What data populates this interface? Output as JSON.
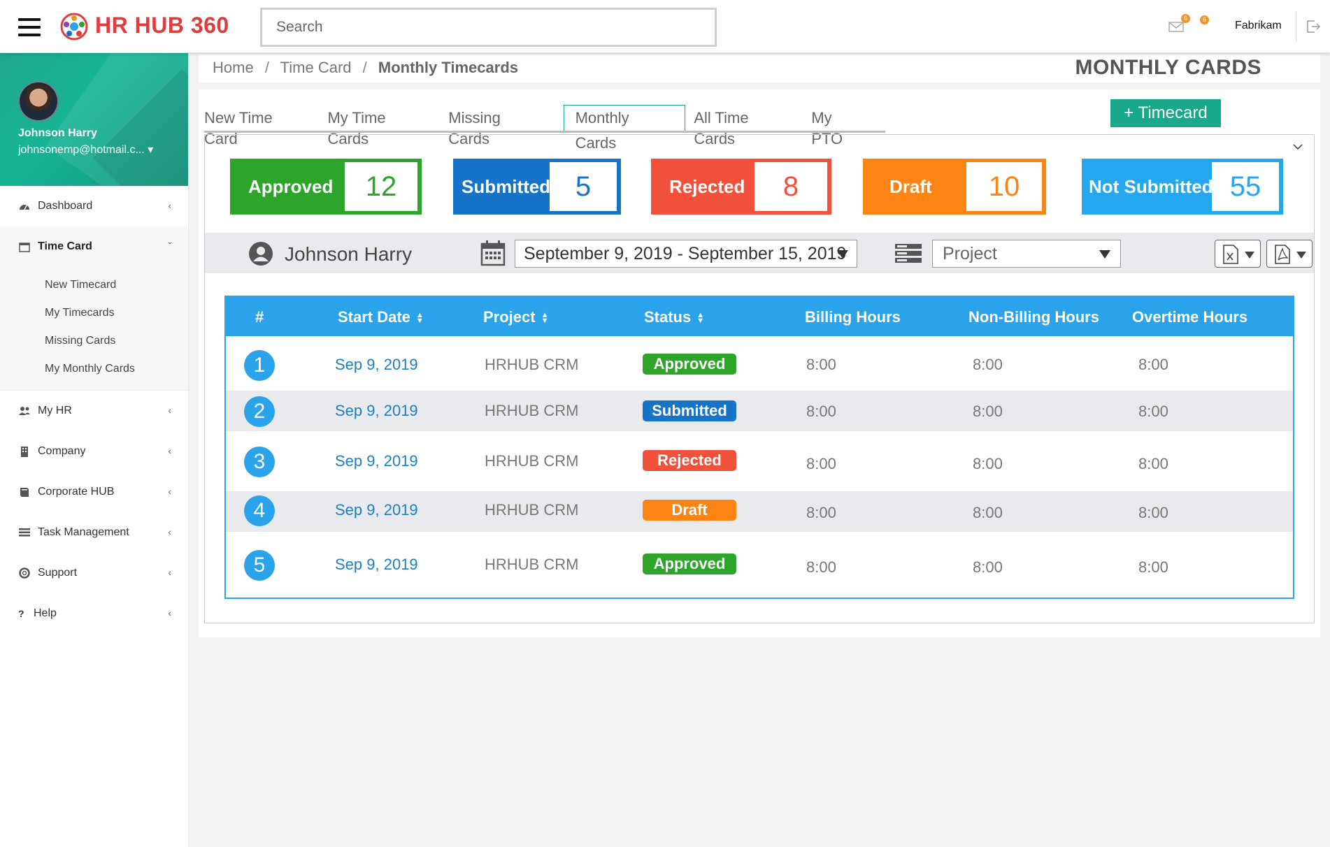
{
  "header": {
    "brand": "HR HUB 360",
    "search_placeholder": "Search",
    "mail_count": "6",
    "notif_count": "6",
    "company": "Fabrikam"
  },
  "profile": {
    "name": "Johnson Harry",
    "email": "johnsonemp@hotmail.c... ▾"
  },
  "sidebar": {
    "items": [
      {
        "label": "Dashboard",
        "icon": "dashboard-icon"
      },
      {
        "label": "Time Card",
        "icon": "calendar-icon"
      },
      {
        "label": "My HR",
        "icon": "users-icon"
      },
      {
        "label": "Company",
        "icon": "building-icon"
      },
      {
        "label": "Corporate HUB",
        "icon": "book-icon"
      },
      {
        "label": "Task Management",
        "icon": "list-icon"
      },
      {
        "label": "Support",
        "icon": "lifebuoy-icon"
      },
      {
        "label": "Help",
        "icon": "question-icon"
      }
    ],
    "time_card_sub": [
      "New Timecard",
      "My Timecards",
      "Missing Cards",
      "My Monthly Cards"
    ]
  },
  "breadcrumb": {
    "home": "Home",
    "section": "Time Card",
    "current": "Monthly Timecards",
    "sep": "/"
  },
  "page_title": "MONTHLY CARDS",
  "tabs": [
    "New Time Card",
    "My Time Cards",
    "Missing Cards",
    "Monthly Cards",
    "All Time Cards",
    "My PTO"
  ],
  "active_tab": "Monthly Cards",
  "add_button": "+ Timecard",
  "stats": [
    {
      "label": "Approved",
      "count": "12",
      "color": "#2ca52a"
    },
    {
      "label": "Submitted",
      "count": "5",
      "color": "#1773c7"
    },
    {
      "label": "Rejected",
      "count": "8",
      "color": "#f1513b"
    },
    {
      "label": "Draft",
      "count": "10",
      "color": "#fb8413"
    },
    {
      "label": "Not Submitted",
      "count": "55",
      "color": "#24a7ef"
    }
  ],
  "filters": {
    "user": "Johnson Harry",
    "date_range": "September 9, 2019 - September 15, 2019",
    "project": "Project"
  },
  "table": {
    "columns": [
      "#",
      "Start Date",
      "Project",
      "Status",
      "Billing Hours",
      "Non-Billing Hours",
      "Overtime Hours"
    ],
    "rows": [
      {
        "num": "1",
        "date": "Sep 9, 2019",
        "project": "HRHUB CRM",
        "status": "Approved",
        "status_color": "#2ca52a",
        "billing": "8:00",
        "nonbilling": "8:00",
        "overtime": "8:00"
      },
      {
        "num": "2",
        "date": "Sep 9, 2019",
        "project": "HRHUB CRM",
        "status": "Submitted",
        "status_color": "#1773c7",
        "billing": "8:00",
        "nonbilling": "8:00",
        "overtime": "8:00"
      },
      {
        "num": "3",
        "date": "Sep 9, 2019",
        "project": "HRHUB CRM",
        "status": "Rejected",
        "status_color": "#f1513b",
        "billing": "8:00",
        "nonbilling": "8:00",
        "overtime": "8:00"
      },
      {
        "num": "4",
        "date": "Sep 9, 2019",
        "project": "HRHUB CRM",
        "status": "Draft",
        "status_color": "#fb8413",
        "billing": "8:00",
        "nonbilling": "8:00",
        "overtime": "8:00"
      },
      {
        "num": "5",
        "date": "Sep 9, 2019",
        "project": "HRHUB CRM",
        "status": "Approved",
        "status_color": "#2ca52a",
        "billing": "8:00",
        "nonbilling": "8:00",
        "overtime": "8:00"
      }
    ]
  }
}
